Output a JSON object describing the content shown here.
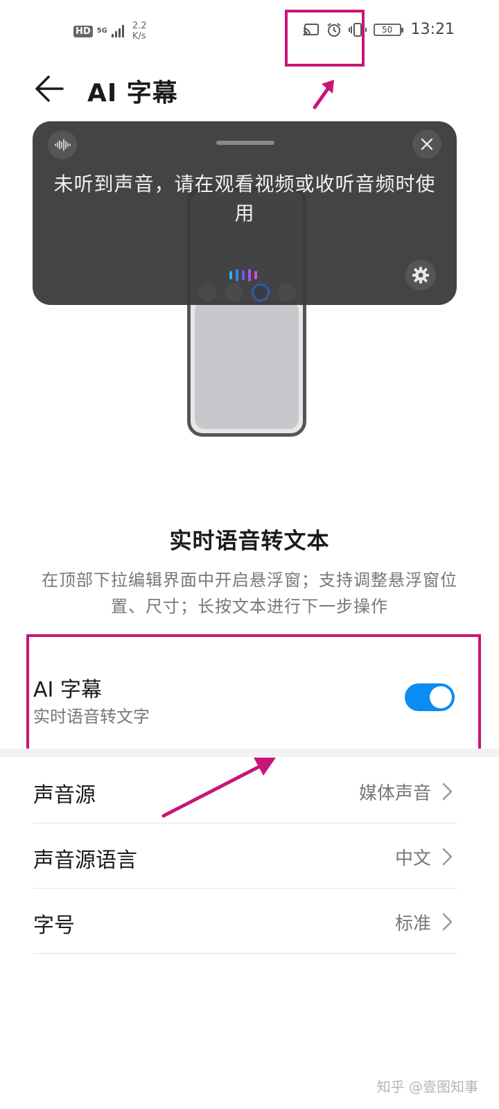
{
  "status_bar": {
    "hd": "HD",
    "network": "5G",
    "speed_value": "2.2",
    "speed_unit": "K/s",
    "battery": "50",
    "time": "13:21",
    "icons": [
      "cast-icon",
      "alarm-icon",
      "vibrate-icon",
      "battery-icon"
    ]
  },
  "header": {
    "title": "AI 字幕",
    "back_icon": "back-arrow-icon"
  },
  "caption_preview": {
    "text": "未听到声音，请在观看视频或收听音频时使用",
    "bar_colors": [
      "#2bb3f0",
      "#3a7ff0",
      "#6a5cf0",
      "#b04ff0",
      "#e04fd0"
    ]
  },
  "section": {
    "title": "实时语音转文本",
    "description": "在顶部下拉编辑界面中开启悬浮窗；支持调整悬浮窗位置、尺寸；长按文本进行下一步操作"
  },
  "toggle": {
    "title": "AI 字幕",
    "subtitle": "实时语音转文字",
    "enabled": true,
    "accent": "#0a8cf2"
  },
  "settings": [
    {
      "label": "声音源",
      "value": "媒体声音"
    },
    {
      "label": "声音源语言",
      "value": "中文"
    },
    {
      "label": "字号",
      "value": "标准"
    }
  ],
  "annotation_color": "#c8157a",
  "watermark": "知乎 @壹图知事"
}
